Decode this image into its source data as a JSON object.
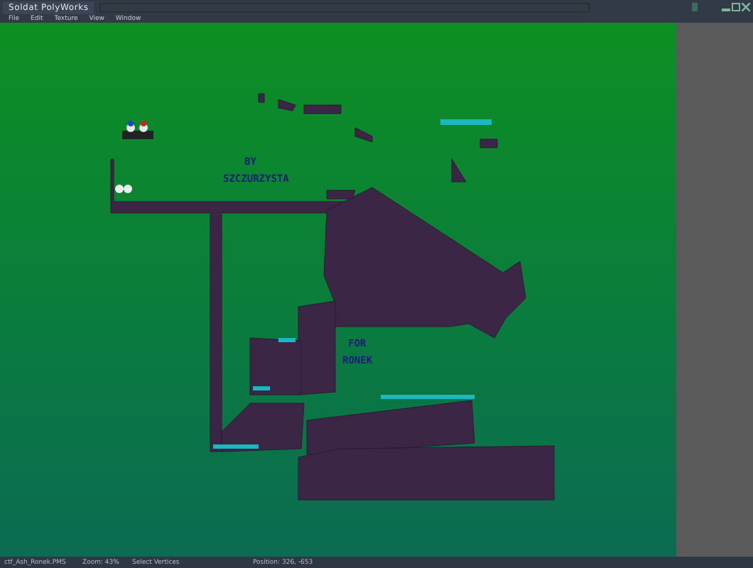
{
  "window": {
    "title": "Soldat PolyWorks"
  },
  "menu": [
    "File",
    "Edit",
    "Texture",
    "View",
    "Window"
  ],
  "map_texts": [
    "BY",
    "SZCZURZYSTA",
    "FOR",
    "RONEK"
  ],
  "status_bar": {
    "file": "ctf_Ash_Ronek.PMS",
    "zoom": "Zoom: 43%",
    "tool": "Select Vertices",
    "position": "Position: 326, -653"
  }
}
